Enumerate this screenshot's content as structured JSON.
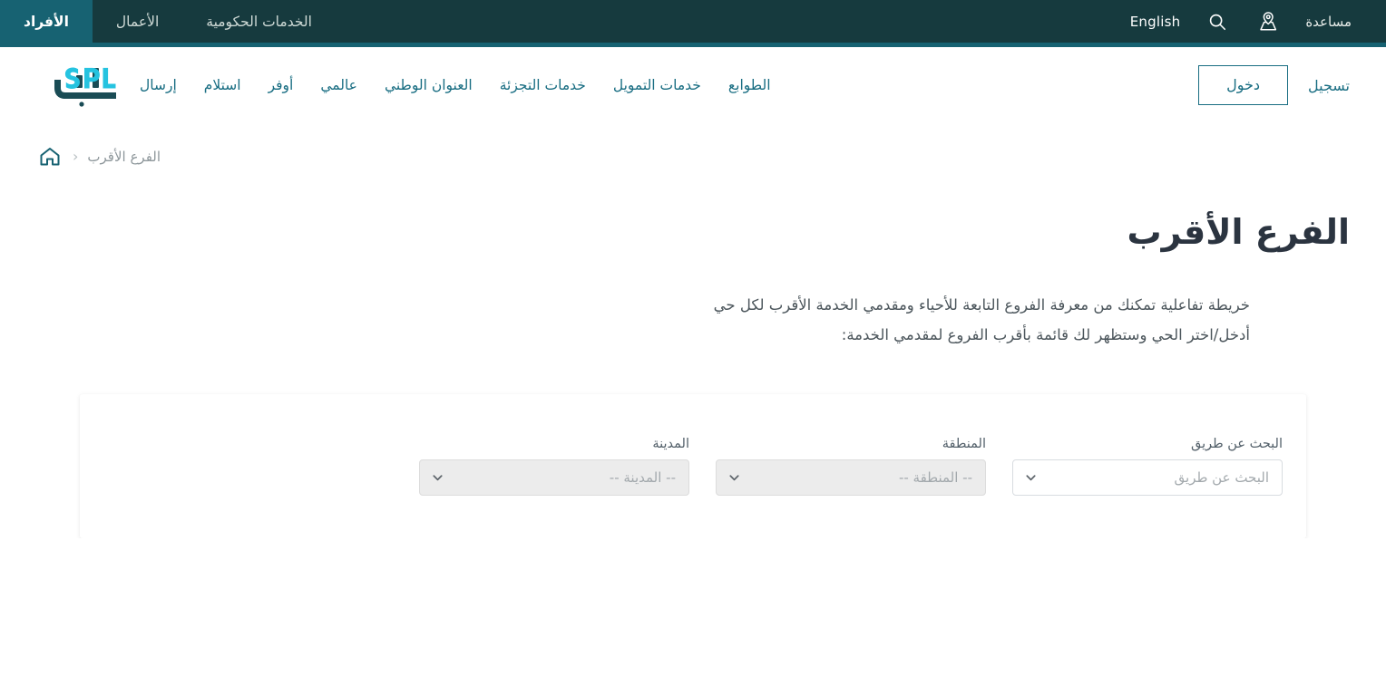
{
  "colors": {
    "topbar_bg": "#163a3e",
    "accent_teal": "#176272",
    "nav_link": "#186d82",
    "logo_cyan": "#25c3e0",
    "logo_dark": "#1a4c55",
    "title": "#2b3440",
    "muted": "#8e979b"
  },
  "topbar": {
    "language_label": "English",
    "search_icon": "search-icon",
    "locator_icon": "map-pin-icon",
    "help_label": "مساعدة",
    "audience_tabs": [
      {
        "label": "الخدمات الحكومية",
        "active": false
      },
      {
        "label": "الأعمال",
        "active": false
      },
      {
        "label": "الأفراد",
        "active": true
      }
    ]
  },
  "header": {
    "logo_latin": "SPL",
    "logo_arabic": "سبل",
    "nav_items": [
      {
        "label": "إرسال"
      },
      {
        "label": "استلام"
      },
      {
        "label": "أوفر"
      },
      {
        "label": "عالمي"
      },
      {
        "label": "العنوان الوطني"
      },
      {
        "label": "خدمات التجزئة"
      },
      {
        "label": "خدمات التمويل"
      },
      {
        "label": "الطوابع"
      }
    ],
    "login_label": "دخول",
    "register_label": "تسجيل"
  },
  "breadcrumb": {
    "home_icon": "home-icon",
    "separator": "‹",
    "current": "الفرع الأقرب"
  },
  "main": {
    "title": "الفرع الأقرب",
    "description_line1": "خريطة تفاعلية تمكنك من معرفة الفروع التابعة للأحياء ومقدمي الخدمة الأقرب لكل حي",
    "description_line2": "أدخل/اختر الحي وستظهر لك قائمة بأقرب الفروع لمقدمي الخدمة:"
  },
  "filters": [
    {
      "label": "البحث عن طريق",
      "value": "البحث عن طريق",
      "disabled": false,
      "name": "search-by"
    },
    {
      "label": "المنطقة",
      "value": "-- المنطقة --",
      "disabled": true,
      "name": "region"
    },
    {
      "label": "المدينة",
      "value": "-- المدينة --",
      "disabled": true,
      "name": "city"
    }
  ]
}
